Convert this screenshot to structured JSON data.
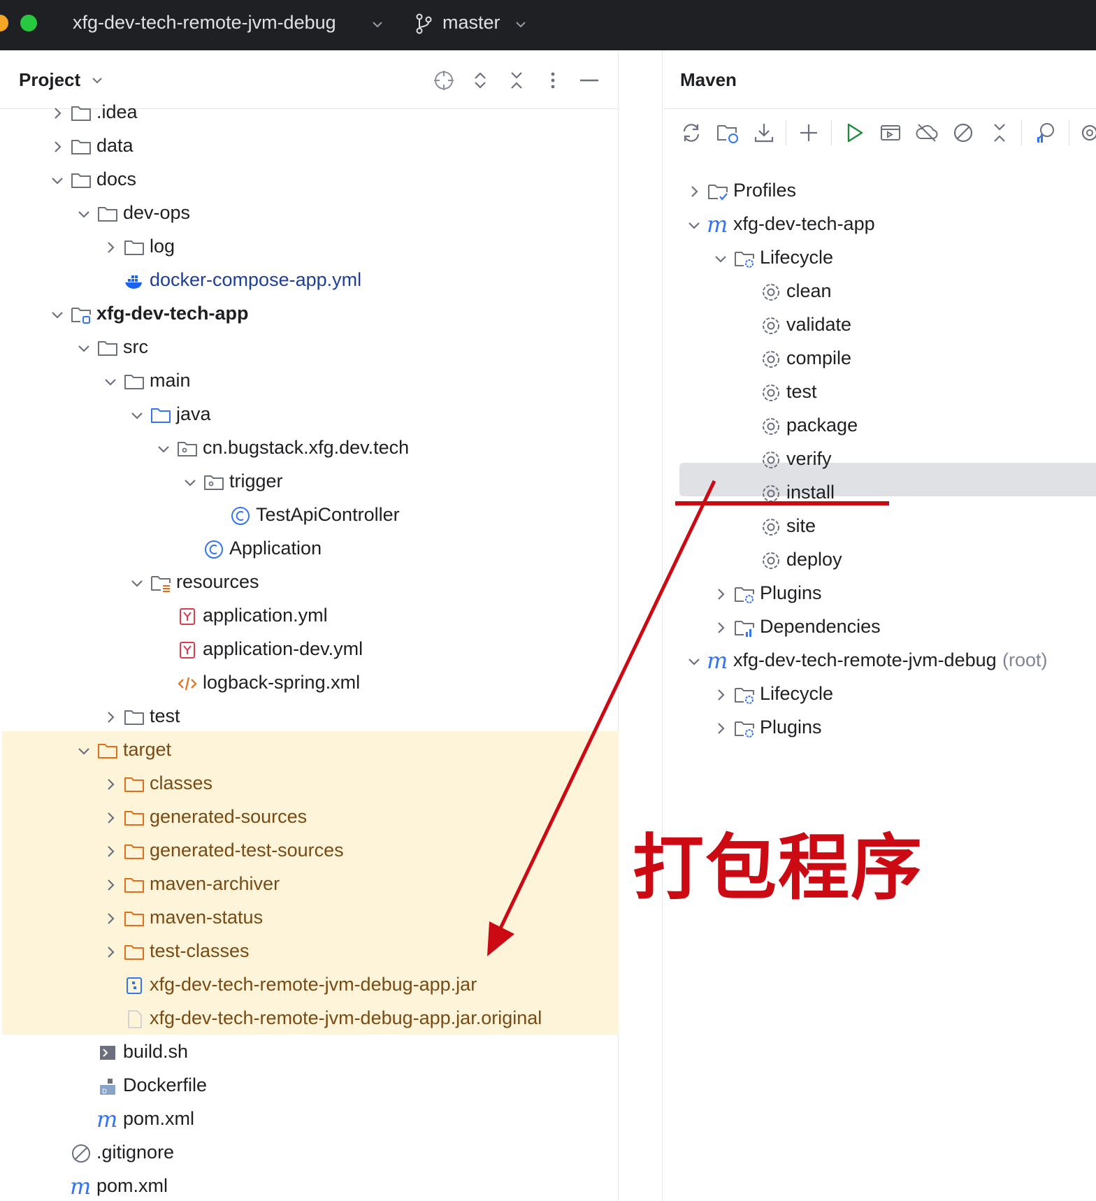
{
  "titlebar": {
    "project_name": "xfg-dev-tech-remote-jvm-debug",
    "branch": "master"
  },
  "project_panel": {
    "title": "Project",
    "tree": [
      {
        "label": "idea",
        "prefix": ".",
        "icon": "folder-icon",
        "expanded": false
      },
      {
        "label": "data",
        "icon": "folder-icon",
        "expanded": false
      },
      {
        "label": "docs",
        "icon": "folder-icon",
        "expanded": true
      },
      {
        "label": "dev-ops",
        "icon": "folder-icon",
        "expanded": true
      },
      {
        "label": "log",
        "icon": "folder-icon",
        "expanded": false
      },
      {
        "label": "docker-compose-app.yml",
        "icon": "docker-icon"
      },
      {
        "label": "xfg-dev-tech-app",
        "icon": "module-folder-icon",
        "expanded": true
      },
      {
        "label": "src",
        "icon": "folder-icon",
        "expanded": true
      },
      {
        "label": "main",
        "icon": "folder-icon",
        "expanded": true
      },
      {
        "label": "java",
        "icon": "source-folder-icon",
        "expanded": true
      },
      {
        "label": "cn.bugstack.xfg.dev.tech",
        "icon": "package-icon",
        "expanded": true
      },
      {
        "label": "trigger",
        "icon": "package-icon",
        "expanded": true
      },
      {
        "label": "TestApiController",
        "icon": "class-icon"
      },
      {
        "label": "Application",
        "icon": "class-icon"
      },
      {
        "label": "resources",
        "icon": "resources-folder-icon",
        "expanded": true
      },
      {
        "label": "application.yml",
        "icon": "yaml-icon"
      },
      {
        "label": "application-dev.yml",
        "icon": "yaml-icon"
      },
      {
        "label": "logback-spring.xml",
        "icon": "xml-icon"
      },
      {
        "label": "test",
        "icon": "folder-icon",
        "expanded": false
      },
      {
        "label": "target",
        "icon": "excluded-folder-icon",
        "expanded": true
      },
      {
        "label": "classes",
        "icon": "excluded-folder-icon",
        "expanded": false
      },
      {
        "label": "generated-sources",
        "icon": "excluded-folder-icon",
        "expanded": false
      },
      {
        "label": "generated-test-sources",
        "icon": "excluded-folder-icon",
        "expanded": false
      },
      {
        "label": "maven-archiver",
        "icon": "excluded-folder-icon",
        "expanded": false
      },
      {
        "label": "maven-status",
        "icon": "excluded-folder-icon",
        "expanded": false
      },
      {
        "label": "test-classes",
        "icon": "excluded-folder-icon",
        "expanded": false
      },
      {
        "label": "xfg-dev-tech-remote-jvm-debug-app.jar",
        "icon": "jar-icon"
      },
      {
        "label": "xfg-dev-tech-remote-jvm-debug-app.jar.original",
        "icon": "file-icon"
      },
      {
        "label": "build.sh",
        "icon": "shell-icon"
      },
      {
        "label": "Dockerfile",
        "icon": "dockerfile-icon"
      },
      {
        "label": "pom.xml",
        "icon": "maven-icon"
      },
      {
        "label": ".gitignore",
        "icon": "ignore-icon"
      },
      {
        "label": "pom.xml",
        "icon": "maven-icon"
      }
    ]
  },
  "maven_panel": {
    "title": "Maven",
    "tree": [
      {
        "label": "Profiles",
        "icon": "profiles-icon",
        "expanded": false
      },
      {
        "label": "xfg-dev-tech-app",
        "icon": "maven-icon",
        "expanded": true
      },
      {
        "label": "Lifecycle",
        "icon": "lifecycle-folder-icon",
        "expanded": true
      },
      {
        "label": "clean",
        "icon": "gear-icon"
      },
      {
        "label": "validate",
        "icon": "gear-icon"
      },
      {
        "label": "compile",
        "icon": "gear-icon"
      },
      {
        "label": "test",
        "icon": "gear-icon"
      },
      {
        "label": "package",
        "icon": "gear-icon"
      },
      {
        "label": "verify",
        "icon": "gear-icon"
      },
      {
        "label": "install",
        "icon": "gear-icon",
        "selected": true
      },
      {
        "label": "site",
        "icon": "gear-icon"
      },
      {
        "label": "deploy",
        "icon": "gear-icon"
      },
      {
        "label": "Plugins",
        "icon": "lifecycle-folder-icon",
        "expanded": false
      },
      {
        "label": "Dependencies",
        "icon": "dependencies-folder-icon",
        "expanded": false
      },
      {
        "label": "xfg-dev-tech-remote-jvm-debug",
        "suffix": "(root)",
        "icon": "maven-icon",
        "expanded": true
      },
      {
        "label": "Lifecycle",
        "icon": "lifecycle-folder-icon",
        "expanded": false
      },
      {
        "label": "Plugins",
        "icon": "lifecycle-folder-icon",
        "expanded": false
      }
    ]
  },
  "annotation": {
    "text": "打包程序",
    "color": "#cc0a14"
  },
  "colors": {
    "titlebar_bg": "#1f2023",
    "excluded_highlight": "#fdf4d9",
    "selection": "#dfe1e5",
    "blue_text": "#1d3f9a",
    "excluded_text": "#7a4a12"
  }
}
